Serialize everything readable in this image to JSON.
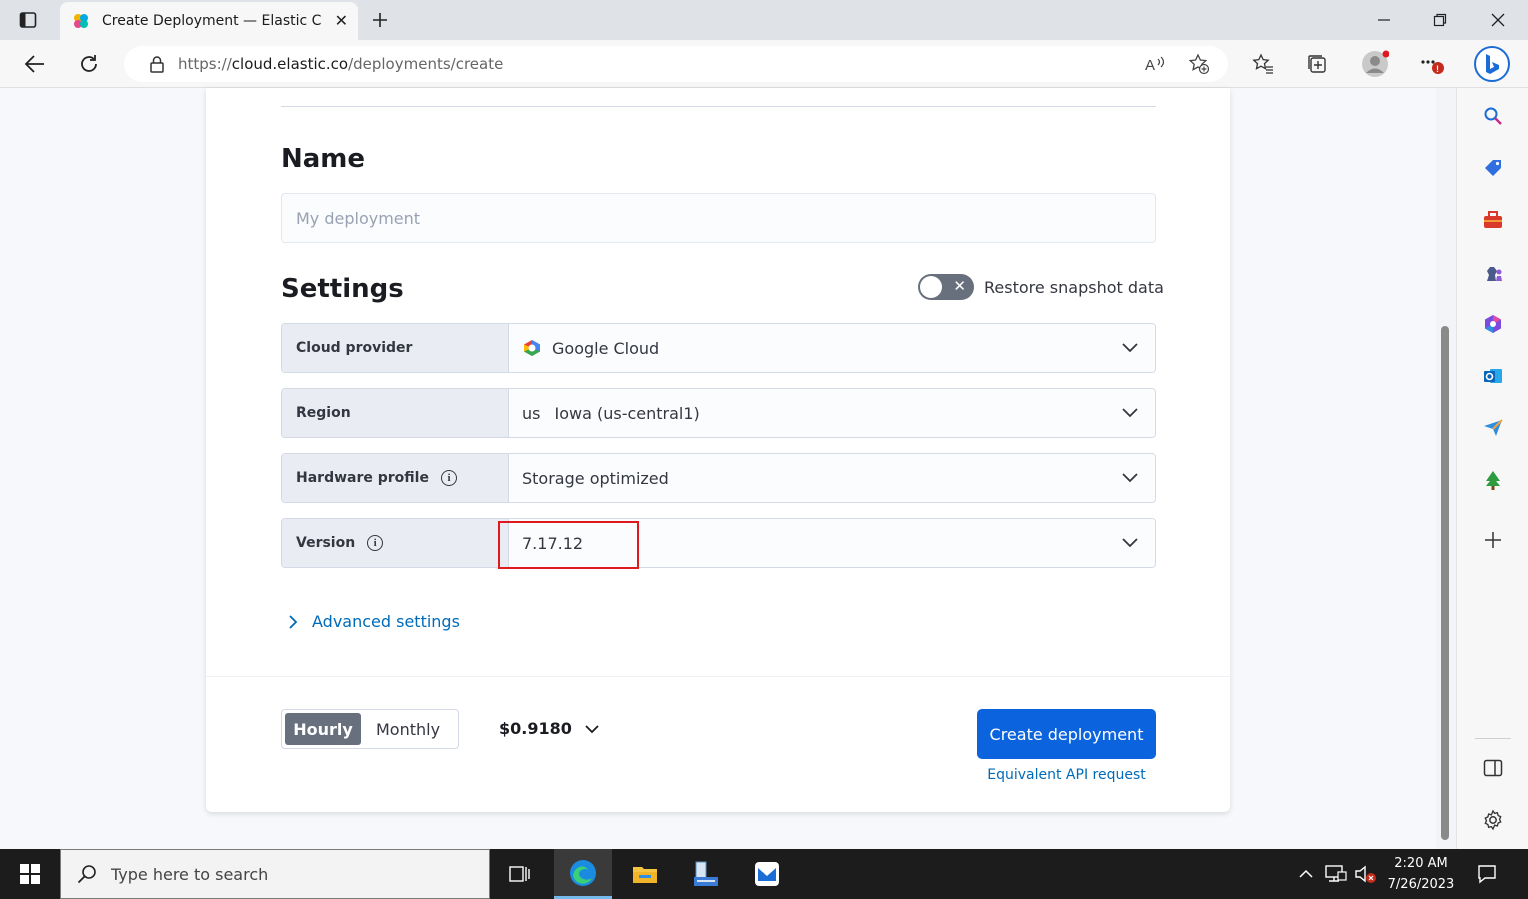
{
  "browser": {
    "tab_title": "Create Deployment — Elastic Clo",
    "url_scheme": "https://",
    "url_host": "cloud.elastic.co",
    "url_path": "/deployments/create",
    "new_tab_label": "+",
    "close_tab_label": "✕"
  },
  "form": {
    "name_heading": "Name",
    "name_placeholder": "My deployment",
    "settings_heading": "Settings",
    "restore_label": "Restore snapshot data",
    "rows": [
      {
        "label": "Cloud provider",
        "value": "Google Cloud"
      },
      {
        "label": "Region",
        "code": "us",
        "value": "Iowa (us-central1)"
      },
      {
        "label": "Hardware profile",
        "value": "Storage optimized"
      },
      {
        "label": "Version",
        "value": "7.17.12"
      }
    ],
    "info_glyph": "i",
    "advanced_label": "Advanced settings"
  },
  "footer": {
    "hourly_label": "Hourly",
    "monthly_label": "Monthly",
    "price": "$0.9180",
    "create_label": "Create deployment",
    "api_label": "Equivalent API request"
  },
  "taskbar": {
    "search_placeholder": "Type here to search",
    "time": "2:20 AM",
    "date": "7/26/2023"
  },
  "colors": {
    "primary": "#0b64dd",
    "link": "#006bb8",
    "highlight": "#e0191e"
  }
}
